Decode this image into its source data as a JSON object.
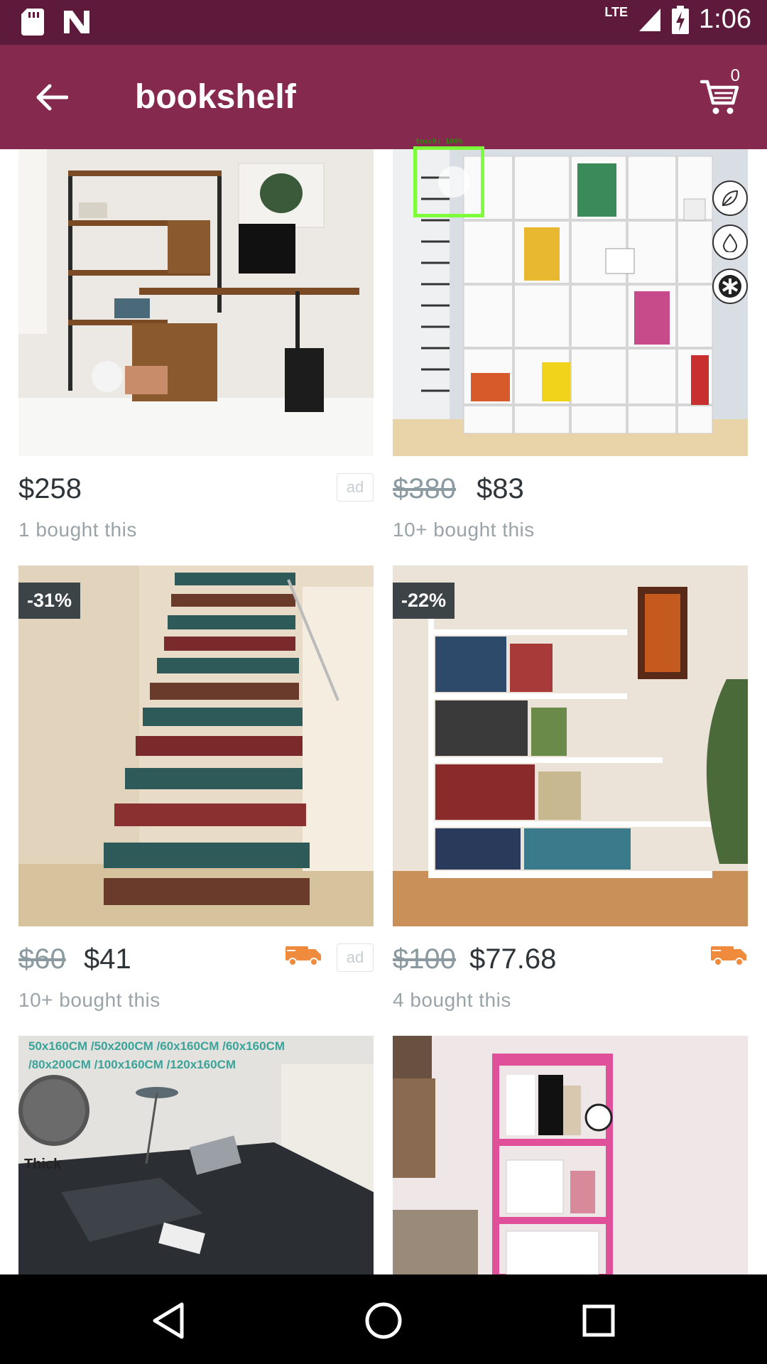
{
  "status_bar": {
    "time": "1:06",
    "network": "LTE"
  },
  "app_bar": {
    "title": "bookshelf",
    "cart_count": "0"
  },
  "products": [
    {
      "old_price": "",
      "price": "$258",
      "bought": "1 bought this",
      "discount": "",
      "ad": "ad",
      "free_shipping": false
    },
    {
      "old_price": "$380",
      "price": "$83",
      "bought": "10+ bought this",
      "discount": "",
      "ad": "",
      "free_shipping": false
    },
    {
      "old_price": "$60",
      "price": "$41",
      "bought": "10+ bought this",
      "discount": "-31%",
      "ad": "ad",
      "free_shipping": true
    },
    {
      "old_price": "$100",
      "price": "$77.68",
      "bought": "4 bought this",
      "discount": "-22%",
      "ad": "",
      "free_shipping": true
    },
    {
      "image_text_line1": "50x160CM /50x200CM /60x160CM /60x160CM",
      "image_text_line2": "/80x200CM /100x160CM /120x160CM",
      "image_text_thick": "Thick"
    },
    {}
  ],
  "touch_overlay": {
    "label": "touch: 100%"
  },
  "colors": {
    "status_bar": "#5e1a3b",
    "app_bar": "#86294f",
    "discount_badge": "#3d4448",
    "truck": "#f08a3c"
  }
}
